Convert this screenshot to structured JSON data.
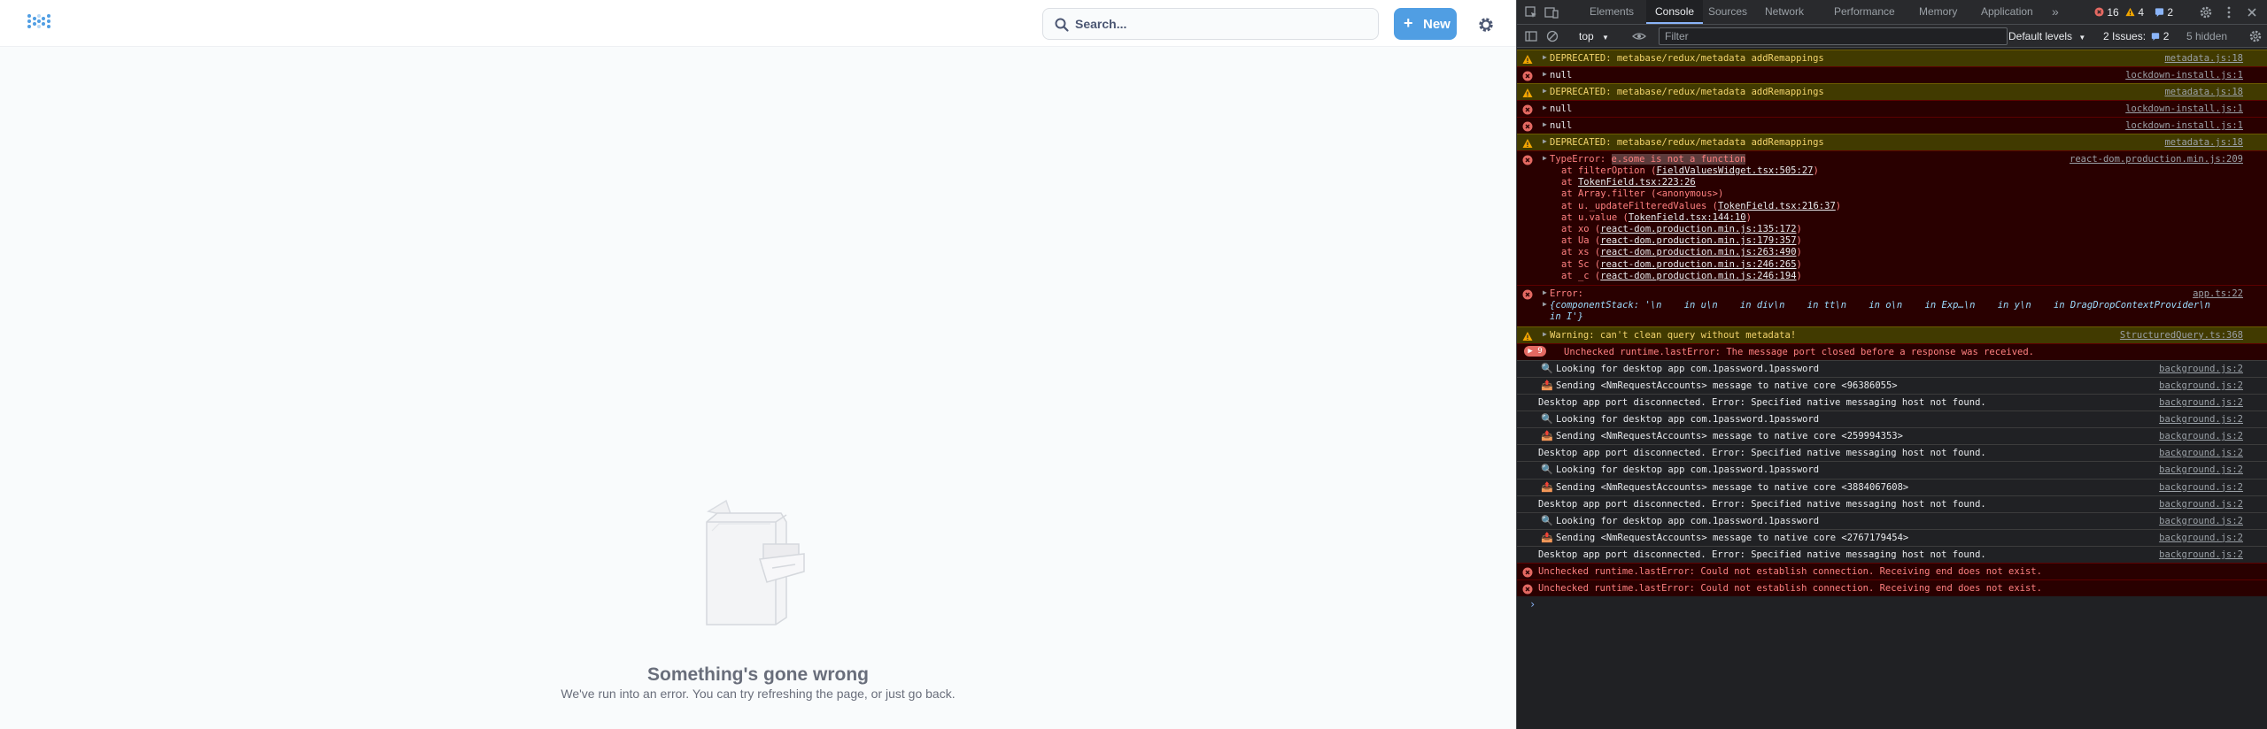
{
  "app": {
    "search_label": "Search...",
    "new_label": "New",
    "error_title": "Something's gone wrong",
    "error_subtitle": "We've run into an error. You can try refreshing the page, or just go back."
  },
  "devtools": {
    "tabs": [
      "Elements",
      "Console",
      "Sources",
      "Network",
      "Performance",
      "Memory",
      "Application"
    ],
    "more_tabs": "»",
    "errors_count": "16",
    "warnings_count": "4",
    "messages_count": "2",
    "context": "top",
    "filter_placeholder": "Filter",
    "levels": "Default levels",
    "issues_label": "2 Issues:",
    "issues_count": "2",
    "hidden_label": "5 hidden",
    "colors": {
      "accent": "#8ab4f8",
      "error": "#ff8080",
      "warning": "#f2d36c"
    }
  },
  "console": {
    "rows": [
      {
        "level": "warning",
        "msg": "DEPRECATED: metabase/redux/metadata addRemappings",
        "src": "metadata.js:18"
      },
      {
        "level": "error",
        "msg": "null",
        "src": "lockdown-install.js:1"
      },
      {
        "level": "warning",
        "msg": "DEPRECATED: metabase/redux/metadata addRemappings",
        "src": "metadata.js:18"
      },
      {
        "level": "error",
        "msg": "null",
        "src": "lockdown-install.js:1"
      },
      {
        "level": "error",
        "msg": "null",
        "src": "lockdown-install.js:1"
      },
      {
        "level": "warning",
        "msg": "DEPRECATED: metabase/redux/metadata addRemappings",
        "src": "metadata.js:18"
      }
    ],
    "typeerror": {
      "prefix": "TypeError: ",
      "highlight": "e.some is not a function",
      "src": "react-dom.production.min.js:209",
      "stack": [
        {
          "pre": "at filterOption (",
          "link": "FieldValuesWidget.tsx:505:27",
          "post": ")"
        },
        {
          "pre": "at ",
          "link": "TokenField.tsx:223:26",
          "post": ""
        },
        {
          "pre": "at Array.filter (<anonymous>)",
          "link": "",
          "post": ""
        },
        {
          "pre": "at u._updateFilteredValues (",
          "link": "TokenField.tsx:216:37",
          "post": ")"
        },
        {
          "pre": "at u.value (",
          "link": "TokenField.tsx:144:10",
          "post": ")"
        },
        {
          "pre": "at xo (",
          "link": "react-dom.production.min.js:135:172",
          "post": ")"
        },
        {
          "pre": "at Ua (",
          "link": "react-dom.production.min.js:179:357",
          "post": ")"
        },
        {
          "pre": "at xs (",
          "link": "react-dom.production.min.js:263:490",
          "post": ")"
        },
        {
          "pre": "at Sc (",
          "link": "react-dom.production.min.js:246:265",
          "post": ")"
        },
        {
          "pre": "at _c (",
          "link": "react-dom.production.min.js:246:194",
          "post": ")"
        }
      ]
    },
    "error_component": {
      "title": "Error:",
      "src": "app.ts:22",
      "line1": "{componentStack: '\\n    in u\\n    in div\\n    in tt\\n    in o\\n    in Exp…\\n    in y\\n    in DragDropContextProvider\\n",
      "line2": "in I'}"
    },
    "warning_query": {
      "msg": "Warning: can't clean query without metadata!",
      "src": "StructuredQuery.ts:368"
    },
    "runtime_group": {
      "count": "9",
      "msg": "Unchecked runtime.lastError: The message port closed before a response was received."
    },
    "bg_rows": [
      {
        "kind": "look",
        "msg": "Looking for desktop app com.1password.1password",
        "src": "background.js:2"
      },
      {
        "kind": "send",
        "msg": "Sending <NmRequestAccounts> message to native core <96386055>",
        "src": "background.js:2"
      },
      {
        "kind": "plain",
        "msg": "Desktop app port disconnected. Error: Specified native messaging host not found.",
        "src": "background.js:2"
      },
      {
        "kind": "look",
        "msg": "Looking for desktop app com.1password.1password",
        "src": "background.js:2"
      },
      {
        "kind": "send",
        "msg": "Sending <NmRequestAccounts> message to native core <259994353>",
        "src": "background.js:2"
      },
      {
        "kind": "plain",
        "msg": "Desktop app port disconnected. Error: Specified native messaging host not found.",
        "src": "background.js:2"
      },
      {
        "kind": "look",
        "msg": "Looking for desktop app com.1password.1password",
        "src": "background.js:2"
      },
      {
        "kind": "send",
        "msg": "Sending <NmRequestAccounts> message to native core <3884067608>",
        "src": "background.js:2"
      },
      {
        "kind": "plain",
        "msg": "Desktop app port disconnected. Error: Specified native messaging host not found.",
        "src": "background.js:2"
      },
      {
        "kind": "look",
        "msg": "Looking for desktop app com.1password.1password",
        "src": "background.js:2"
      },
      {
        "kind": "send",
        "msg": "Sending <NmRequestAccounts> message to native core <2767179454>",
        "src": "background.js:2"
      },
      {
        "kind": "plain",
        "msg": "Desktop app port disconnected. Error: Specified native messaging host not found.",
        "src": "background.js:2"
      }
    ],
    "final_errors": [
      "Unchecked runtime.lastError: Could not establish connection. Receiving end does not exist.",
      "Unchecked runtime.lastError: Could not establish connection. Receiving end does not exist."
    ],
    "prompt": "›"
  }
}
